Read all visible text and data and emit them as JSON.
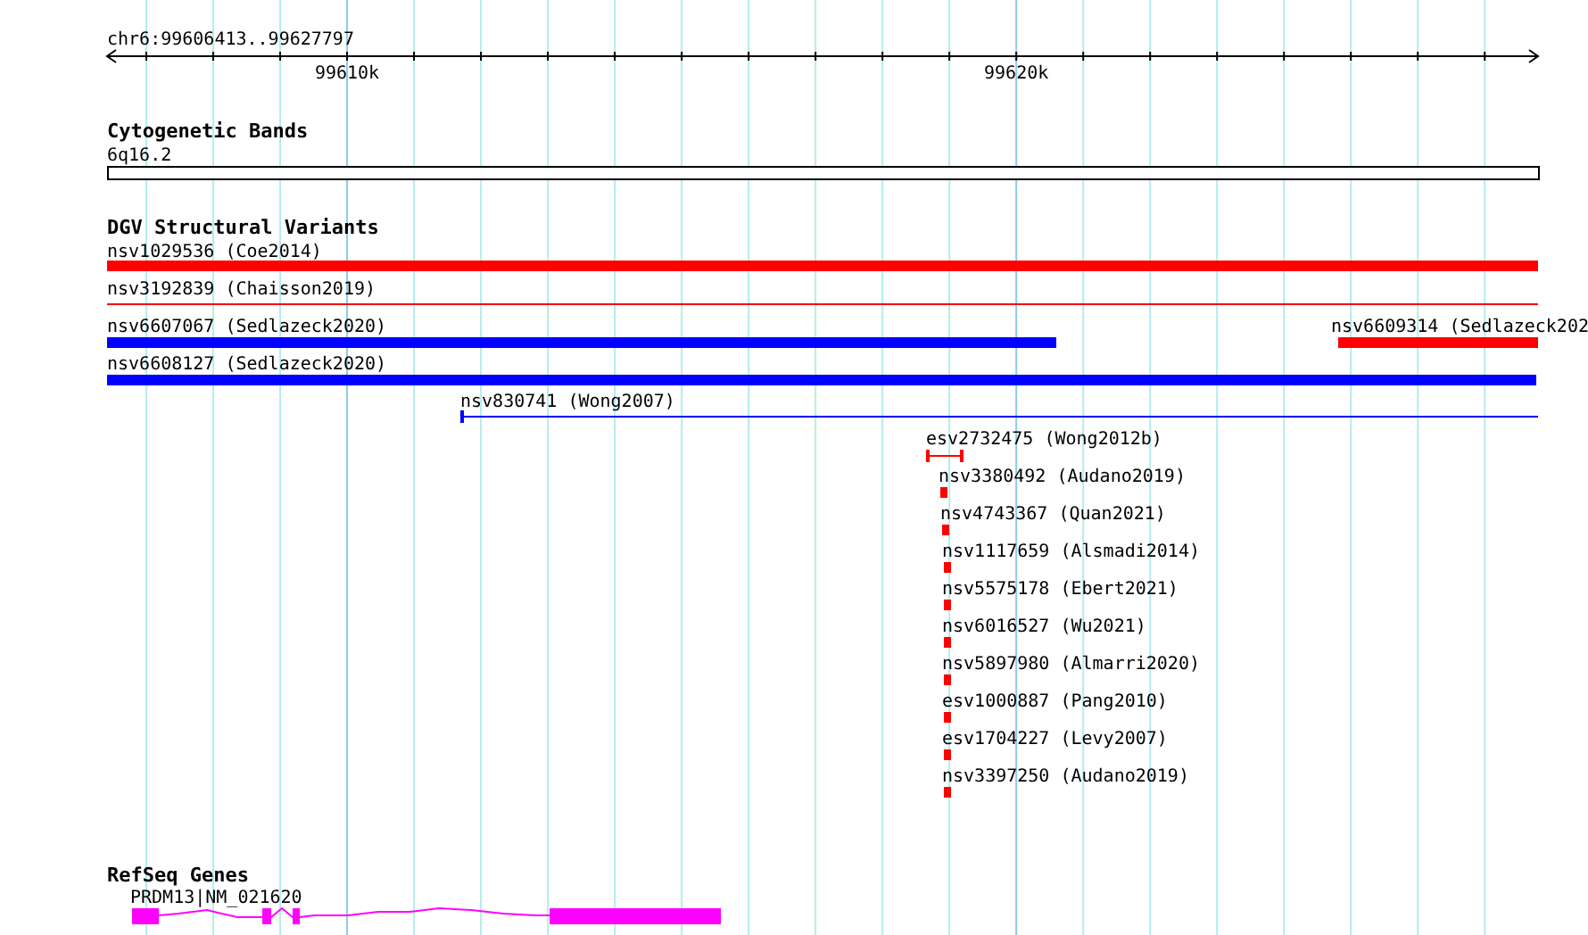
{
  "ruler": {
    "region": "chr6:99606413..99627797",
    "labels": [
      "99610k",
      "99620k"
    ]
  },
  "tracks": [
    {
      "kind": "bands",
      "title": "Cytogenetic Bands",
      "features": [
        {
          "label": "6q16.2",
          "kind": "band",
          "color": "#ffffff"
        }
      ]
    },
    {
      "kind": "variants",
      "title": "DGV Structural Variants",
      "features": [
        {
          "label": "nsv1029536 (Coe2014)",
          "kind": "thick",
          "color": "#ff0000"
        },
        {
          "label": "nsv3192839 (Chaisson2019)",
          "kind": "thin",
          "color": "#ff0000"
        },
        {
          "label": "nsv6607067 (Sedlazeck2020)",
          "kind": "thick",
          "color": "#0000ff"
        },
        {
          "label": "nsv6609314 (Sedlazeck202",
          "kind": "thick",
          "color": "#ff0000"
        },
        {
          "label": "nsv6608127 (Sedlazeck2020)",
          "kind": "thick",
          "color": "#0000ff"
        },
        {
          "label": "nsv830741 (Wong2007)",
          "kind": "thin",
          "color": "#0000ff"
        },
        {
          "label": "esv2732475 (Wong2012b)",
          "kind": "interval",
          "color": "#ff0000"
        },
        {
          "label": "nsv3380492 (Audano2019)",
          "kind": "point",
          "color": "#ff0000"
        },
        {
          "label": "nsv4743367 (Quan2021)",
          "kind": "point",
          "color": "#ff0000"
        },
        {
          "label": "nsv1117659 (Alsmadi2014)",
          "kind": "point",
          "color": "#ff0000"
        },
        {
          "label": "nsv5575178 (Ebert2021)",
          "kind": "point",
          "color": "#ff0000"
        },
        {
          "label": "nsv6016527 (Wu2021)",
          "kind": "point",
          "color": "#ff0000"
        },
        {
          "label": "nsv5897980 (Almarri2020)",
          "kind": "point",
          "color": "#ff0000"
        },
        {
          "label": "esv1000887 (Pang2010)",
          "kind": "point",
          "color": "#ff0000"
        },
        {
          "label": "esv1704227 (Levy2007)",
          "kind": "point",
          "color": "#ff0000"
        },
        {
          "label": "nsv3397250 (Audano2019)",
          "kind": "point",
          "color": "#ff0000"
        }
      ]
    },
    {
      "kind": "genes",
      "title": "RefSeq Genes",
      "features": [
        {
          "label": "PRDM13|NM_021620",
          "kind": "gene",
          "color": "#ff00ff"
        }
      ]
    }
  ]
}
